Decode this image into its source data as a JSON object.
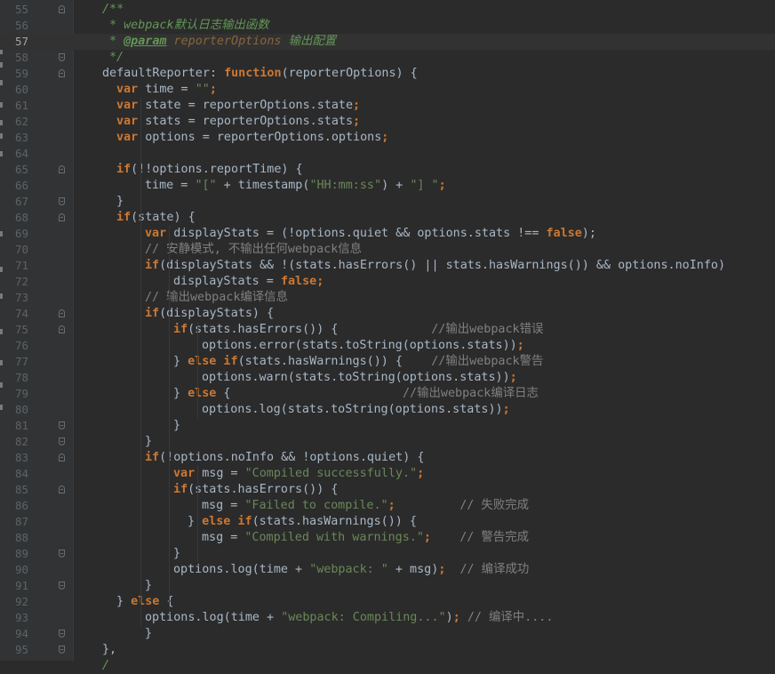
{
  "editor": {
    "current_line": 57,
    "lines": [
      {
        "n": "55",
        "fold": "start",
        "indent": 7,
        "tokens": [
          {
            "t": "/**",
            "c": "doc"
          }
        ]
      },
      {
        "n": "56",
        "fold": "",
        "indent": 8,
        "tokens": [
          {
            "t": "* webpack",
            "c": "doc"
          },
          {
            "t": "默认日志输出函数",
            "c": "doc"
          }
        ]
      },
      {
        "n": "57",
        "fold": "",
        "indent": 8,
        "tokens": [
          {
            "t": "* ",
            "c": "doc"
          },
          {
            "t": "@param",
            "c": "tag"
          },
          {
            "t": " reporterOptions ",
            "c": "docp"
          },
          {
            "t": "输出配置",
            "c": "doc"
          }
        ]
      },
      {
        "n": "58",
        "fold": "end",
        "indent": 8,
        "tokens": [
          {
            "t": "*/",
            "c": "doc"
          }
        ]
      },
      {
        "n": "59",
        "fold": "start",
        "indent": 7,
        "tokens": [
          {
            "t": "defaultReporter",
            "c": ""
          },
          {
            "t": ": ",
            "c": ""
          },
          {
            "t": "function",
            "c": "kw"
          },
          {
            "t": "(reporterOptions) {",
            "c": ""
          }
        ]
      },
      {
        "n": "60",
        "fold": "",
        "indent": 9,
        "tokens": [
          {
            "t": "var",
            "c": "kw"
          },
          {
            "t": " time = ",
            "c": ""
          },
          {
            "t": "\"\"",
            "c": "str"
          },
          {
            "t": ";",
            "c": "kw"
          }
        ]
      },
      {
        "n": "61",
        "fold": "",
        "indent": 9,
        "tokens": [
          {
            "t": "var",
            "c": "kw"
          },
          {
            "t": " state = reporterOptions.state",
            "c": ""
          },
          {
            "t": ";",
            "c": "kw"
          }
        ]
      },
      {
        "n": "62",
        "fold": "",
        "indent": 9,
        "tokens": [
          {
            "t": "var",
            "c": "kw"
          },
          {
            "t": " stats = reporterOptions.stats",
            "c": ""
          },
          {
            "t": ";",
            "c": "kw"
          }
        ]
      },
      {
        "n": "63",
        "fold": "",
        "indent": 9,
        "tokens": [
          {
            "t": "var",
            "c": "kw"
          },
          {
            "t": " options = reporterOptions.options",
            "c": ""
          },
          {
            "t": ";",
            "c": "kw"
          }
        ]
      },
      {
        "n": "64",
        "fold": "",
        "indent": 0,
        "tokens": []
      },
      {
        "n": "65",
        "fold": "start",
        "indent": 9,
        "tokens": [
          {
            "t": "if",
            "c": "kw"
          },
          {
            "t": "(!!options.reportTime) {",
            "c": ""
          }
        ]
      },
      {
        "n": "66",
        "fold": "",
        "indent": 13,
        "tokens": [
          {
            "t": "time = ",
            "c": ""
          },
          {
            "t": "\"[\"",
            "c": "str"
          },
          {
            "t": " + timestamp(",
            "c": ""
          },
          {
            "t": "\"HH:mm:ss\"",
            "c": "str"
          },
          {
            "t": ") + ",
            "c": ""
          },
          {
            "t": "\"] \"",
            "c": "str"
          },
          {
            "t": ";",
            "c": "kw"
          }
        ]
      },
      {
        "n": "67",
        "fold": "end",
        "indent": 9,
        "tokens": [
          {
            "t": "}",
            "c": ""
          }
        ]
      },
      {
        "n": "68",
        "fold": "start",
        "indent": 9,
        "tokens": [
          {
            "t": "if",
            "c": "kw"
          },
          {
            "t": "(state) {",
            "c": ""
          }
        ]
      },
      {
        "n": "69",
        "fold": "",
        "indent": 13,
        "tokens": [
          {
            "t": "var",
            "c": "kw"
          },
          {
            "t": " displayStats = (!options.quiet && options.stats !== ",
            "c": ""
          },
          {
            "t": "false",
            "c": "kw"
          },
          {
            "t": ");",
            "c": ""
          }
        ]
      },
      {
        "n": "70",
        "fold": "",
        "indent": 13,
        "tokens": [
          {
            "t": "// 安静模式, 不输出任何webpack信息",
            "c": "cmt"
          }
        ]
      },
      {
        "n": "71",
        "fold": "",
        "indent": 13,
        "tokens": [
          {
            "t": "if",
            "c": "kw"
          },
          {
            "t": "(displayStats && !(stats.hasErrors() || stats.hasWarnings()) && options.noInfo)",
            "c": ""
          }
        ]
      },
      {
        "n": "72",
        "fold": "",
        "indent": 17,
        "tokens": [
          {
            "t": "displayStats = ",
            "c": ""
          },
          {
            "t": "false",
            "c": "kw"
          },
          {
            "t": ";",
            "c": "kw"
          }
        ]
      },
      {
        "n": "73",
        "fold": "",
        "indent": 13,
        "tokens": [
          {
            "t": "// 输出webpack编译信息",
            "c": "cmt"
          }
        ]
      },
      {
        "n": "74",
        "fold": "start",
        "indent": 13,
        "tokens": [
          {
            "t": "if",
            "c": "kw"
          },
          {
            "t": "(displayStats) {",
            "c": ""
          }
        ]
      },
      {
        "n": "75",
        "fold": "start",
        "indent": 17,
        "tokens": [
          {
            "t": "if",
            "c": "kw"
          },
          {
            "t": "(stats.hasErrors()) {             ",
            "c": ""
          },
          {
            "t": "//输出webpack错误",
            "c": "cmt"
          }
        ]
      },
      {
        "n": "76",
        "fold": "",
        "indent": 21,
        "tokens": [
          {
            "t": "options.error(stats.toString(options.stats))",
            "c": ""
          },
          {
            "t": ";",
            "c": "kw"
          }
        ]
      },
      {
        "n": "77",
        "fold": "",
        "indent": 17,
        "tokens": [
          {
            "t": "} ",
            "c": ""
          },
          {
            "t": "else if",
            "c": "kw"
          },
          {
            "t": "(stats.hasWarnings()) {    ",
            "c": ""
          },
          {
            "t": "//输出webpack警告",
            "c": "cmt"
          }
        ]
      },
      {
        "n": "78",
        "fold": "",
        "indent": 21,
        "tokens": [
          {
            "t": "options.warn(stats.toString(options.stats))",
            "c": ""
          },
          {
            "t": ";",
            "c": "kw"
          }
        ]
      },
      {
        "n": "79",
        "fold": "",
        "indent": 17,
        "tokens": [
          {
            "t": "} ",
            "c": ""
          },
          {
            "t": "else",
            "c": "kw"
          },
          {
            "t": " {                        ",
            "c": ""
          },
          {
            "t": "//输出webpack编译日志",
            "c": "cmt"
          }
        ]
      },
      {
        "n": "80",
        "fold": "",
        "indent": 21,
        "tokens": [
          {
            "t": "options.log(stats.toString(options.stats))",
            "c": ""
          },
          {
            "t": ";",
            "c": "kw"
          }
        ]
      },
      {
        "n": "81",
        "fold": "end",
        "indent": 17,
        "tokens": [
          {
            "t": "}",
            "c": ""
          }
        ]
      },
      {
        "n": "82",
        "fold": "end",
        "indent": 13,
        "tokens": [
          {
            "t": "}",
            "c": ""
          }
        ]
      },
      {
        "n": "83",
        "fold": "start",
        "indent": 13,
        "tokens": [
          {
            "t": "if",
            "c": "kw"
          },
          {
            "t": "(!options.noInfo && !options.quiet) {",
            "c": ""
          }
        ]
      },
      {
        "n": "84",
        "fold": "",
        "indent": 17,
        "tokens": [
          {
            "t": "var",
            "c": "kw"
          },
          {
            "t": " msg = ",
            "c": ""
          },
          {
            "t": "\"Compiled successfully.\"",
            "c": "str"
          },
          {
            "t": ";",
            "c": "kw"
          }
        ]
      },
      {
        "n": "85",
        "fold": "start",
        "indent": 17,
        "tokens": [
          {
            "t": "if",
            "c": "kw"
          },
          {
            "t": "(stats.hasErrors()) {",
            "c": ""
          }
        ]
      },
      {
        "n": "86",
        "fold": "",
        "indent": 21,
        "tokens": [
          {
            "t": "msg = ",
            "c": ""
          },
          {
            "t": "\"Failed to compile.\"",
            "c": "str"
          },
          {
            "t": ";         ",
            "c": "kw"
          },
          {
            "t": "// 失败完成",
            "c": "cmt"
          }
        ]
      },
      {
        "n": "87",
        "fold": "",
        "indent": 19,
        "tokens": [
          {
            "t": "} ",
            "c": ""
          },
          {
            "t": "else if",
            "c": "kw"
          },
          {
            "t": "(stats.hasWarnings()) {",
            "c": ""
          }
        ]
      },
      {
        "n": "88",
        "fold": "",
        "indent": 21,
        "tokens": [
          {
            "t": "msg = ",
            "c": ""
          },
          {
            "t": "\"Compiled with warnings.\"",
            "c": "str"
          },
          {
            "t": ";    ",
            "c": "kw"
          },
          {
            "t": "// 警告完成",
            "c": "cmt"
          }
        ]
      },
      {
        "n": "89",
        "fold": "end",
        "indent": 17,
        "tokens": [
          {
            "t": "}",
            "c": ""
          }
        ]
      },
      {
        "n": "90",
        "fold": "",
        "indent": 17,
        "tokens": [
          {
            "t": "options.log(time + ",
            "c": ""
          },
          {
            "t": "\"webpack: \"",
            "c": "str"
          },
          {
            "t": " + msg)",
            "c": ""
          },
          {
            "t": ";  ",
            "c": "kw"
          },
          {
            "t": "// 编译成功",
            "c": "cmt"
          }
        ]
      },
      {
        "n": "91",
        "fold": "end",
        "indent": 13,
        "tokens": [
          {
            "t": "}",
            "c": ""
          }
        ]
      },
      {
        "n": "92",
        "fold": "",
        "indent": 9,
        "tokens": [
          {
            "t": "} ",
            "c": ""
          },
          {
            "t": "else",
            "c": "kw"
          },
          {
            "t": " {",
            "c": ""
          }
        ]
      },
      {
        "n": "93",
        "fold": "",
        "indent": 13,
        "tokens": [
          {
            "t": "options.log(time + ",
            "c": ""
          },
          {
            "t": "\"webpack: Compiling...\"",
            "c": "str"
          },
          {
            "t": ")",
            "c": ""
          },
          {
            "t": "; ",
            "c": "kw"
          },
          {
            "t": "// 编译中....",
            "c": "cmt"
          }
        ]
      },
      {
        "n": "94",
        "fold": "end",
        "indent": 13,
        "tokens": [
          {
            "t": "}",
            "c": ""
          }
        ]
      },
      {
        "n": "95",
        "fold": "end",
        "indent": 7,
        "tokens": [
          {
            "t": "},",
            "c": ""
          }
        ]
      },
      {
        "n": "",
        "fold": "",
        "indent": 7,
        "tokens": [
          {
            "t": "/",
            "c": "doc"
          }
        ]
      }
    ]
  },
  "colors": {
    "background": "#2b2b2b",
    "gutter": "#313335",
    "keyword": "#cc7832",
    "string": "#6a8759",
    "comment": "#808080",
    "doc_comment": "#629755",
    "default_text": "#a9b7c6"
  }
}
